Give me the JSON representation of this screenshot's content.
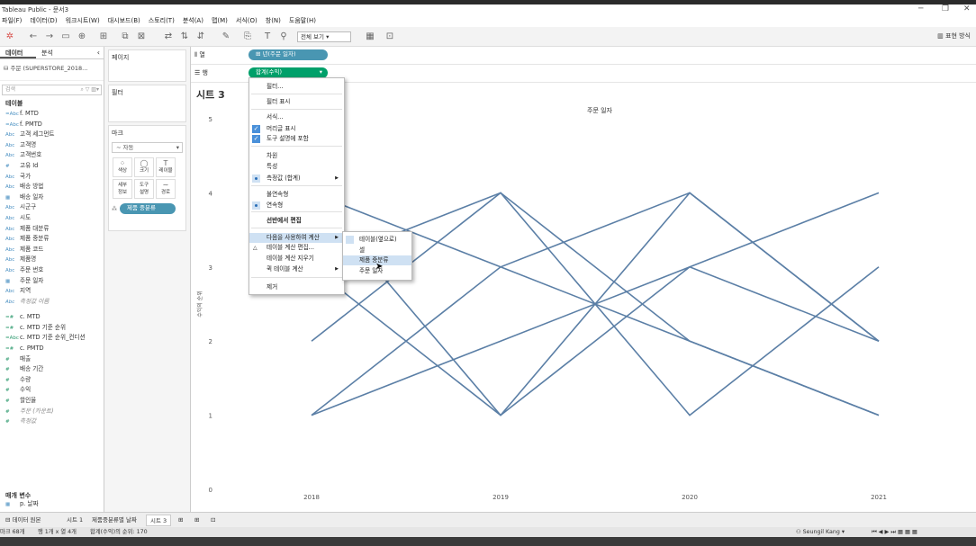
{
  "window": {
    "title": "Tableau Public - 문서3"
  },
  "menubar": [
    "파일(F)",
    "데이터(D)",
    "워크시트(W)",
    "대시보드(B)",
    "스토리(T)",
    "분석(A)",
    "맵(M)",
    "서식(O)",
    "창(N)",
    "도움말(H)"
  ],
  "toolbar": {
    "fit_select": "전체 보기",
    "show_me": "표현 방식"
  },
  "datapane": {
    "tabs": [
      "데이터",
      "분석"
    ],
    "datasource": "주문 (SUPERSTORE_2018...",
    "search_placeholder": "검색",
    "section_tables": "테이블",
    "fields": [
      {
        "t": "=Abc",
        "n": "f. MTD",
        "m": false,
        "i": false
      },
      {
        "t": "=Abc",
        "n": "f. PMTD",
        "m": false,
        "i": false
      },
      {
        "t": "Abc",
        "n": "고객 세그먼트",
        "m": false,
        "i": false
      },
      {
        "t": "Abc",
        "n": "고객명",
        "m": false,
        "i": false
      },
      {
        "t": "Abc",
        "n": "고객번호",
        "m": false,
        "i": false
      },
      {
        "t": "#",
        "n": "고유 Id",
        "m": false,
        "i": false
      },
      {
        "t": "Abc",
        "n": "국가",
        "m": false,
        "i": false
      },
      {
        "t": "Abc",
        "n": "배송 방법",
        "m": false,
        "i": false
      },
      {
        "t": "▦",
        "n": "배송 일자",
        "m": false,
        "i": false
      },
      {
        "t": "Abc",
        "n": "시군구",
        "m": false,
        "i": false
      },
      {
        "t": "Abc",
        "n": "시도",
        "m": false,
        "i": false
      },
      {
        "t": "Abc",
        "n": "제품 대분류",
        "m": false,
        "i": false
      },
      {
        "t": "Abc",
        "n": "제품 중분류",
        "m": false,
        "i": false
      },
      {
        "t": "Abc",
        "n": "제품 코드",
        "m": false,
        "i": false
      },
      {
        "t": "Abc",
        "n": "제품명",
        "m": false,
        "i": false
      },
      {
        "t": "Abc",
        "n": "주문 번호",
        "m": false,
        "i": false
      },
      {
        "t": "▦",
        "n": "주문 일자",
        "m": false,
        "i": false
      },
      {
        "t": "Abc",
        "n": "지역",
        "m": false,
        "i": false
      },
      {
        "t": "Abc",
        "n": "측정값 이름",
        "m": false,
        "i": true
      },
      {
        "t": "=#",
        "n": "c. MTD",
        "m": true,
        "i": false
      },
      {
        "t": "=#",
        "n": "c. MTD 기준 순위",
        "m": true,
        "i": false
      },
      {
        "t": "=Abc",
        "n": "c. MTD 기준 순위_컨디션",
        "m": true,
        "i": false
      },
      {
        "t": "=#",
        "n": "c. PMTD",
        "m": true,
        "i": false
      },
      {
        "t": "#",
        "n": "매출",
        "m": true,
        "i": false
      },
      {
        "t": "#",
        "n": "배송 기간",
        "m": true,
        "i": false
      },
      {
        "t": "#",
        "n": "수량",
        "m": true,
        "i": false
      },
      {
        "t": "#",
        "n": "수익",
        "m": true,
        "i": false
      },
      {
        "t": "#",
        "n": "할인율",
        "m": true,
        "i": false
      },
      {
        "t": "#",
        "n": "주문 (카운트)",
        "m": true,
        "i": true
      },
      {
        "t": "#",
        "n": "측정값",
        "m": true,
        "i": true
      }
    ],
    "section_params": "매개 변수",
    "params": [
      {
        "t": "▦",
        "n": "p. 날짜"
      }
    ]
  },
  "cards": {
    "pages": "페이지",
    "filters": "필터",
    "marks": "마크",
    "mark_type": "자동",
    "mark_buttons": [
      {
        "icon": "⁘",
        "label": "색상"
      },
      {
        "icon": "◯",
        "label": "크기"
      },
      {
        "icon": "T",
        "label": "레이블"
      },
      {
        "icon": "",
        "label": "세부\n정보"
      },
      {
        "icon": "",
        "label": "도구\n설명"
      },
      {
        "icon": "∼",
        "label": "경로"
      }
    ],
    "detail_pill": "제품 중분류"
  },
  "shelves": {
    "columns_label": "열",
    "rows_label": "행",
    "columns_pill": "년(주문 일자)",
    "rows_pill": "합계(수익)"
  },
  "sheet": {
    "title": "시트 3"
  },
  "context_menu": {
    "items": [
      "필터...",
      "필터 표시",
      "서식...",
      "머리글 표시",
      "도구 설명에 포함",
      "차원",
      "특성",
      "측정값 (합계)",
      "불연속형",
      "연속형",
      "선반에서 편집",
      "다음을 사용하여 계산",
      "테이블 계산 편집...",
      "테이블 계산 지우기",
      "퀵 테이블 계산",
      "제거"
    ],
    "submenu": [
      "테이블(옆으로)",
      "셀",
      "제품 중분류",
      "주문 일자"
    ]
  },
  "chart_data": {
    "type": "line",
    "title": "주문 일자",
    "xlabel": "",
    "ylabel": "수익의 순위",
    "categories": [
      "2018",
      "2019",
      "2020",
      "2021"
    ],
    "ylim": [
      0,
      5
    ],
    "yticks": [
      0,
      1,
      2,
      3,
      4,
      5
    ],
    "line_color": "#5b7fa6",
    "series": [
      {
        "values": [
          4,
          3,
          2,
          1
        ]
      },
      {
        "values": [
          3,
          1,
          4,
          2
        ]
      },
      {
        "values": [
          2,
          4,
          1,
          3
        ]
      },
      {
        "values": [
          1,
          2,
          3,
          4
        ]
      },
      {
        "values": [
          4,
          1,
          3,
          2
        ]
      },
      {
        "values": [
          3,
          4,
          2,
          1
        ]
      },
      {
        "values": [
          1,
          3,
          4,
          2
        ]
      }
    ]
  },
  "bottom_tabs": [
    "데이터 원본",
    "시트 1",
    "제품중분류별 날짜",
    "시트 3"
  ],
  "status": {
    "marks": "마크 68개",
    "rows": "행 1개 x 열 4개",
    "sum": "합계(수익)의 순위: 170",
    "user": "Seungil Kang"
  }
}
